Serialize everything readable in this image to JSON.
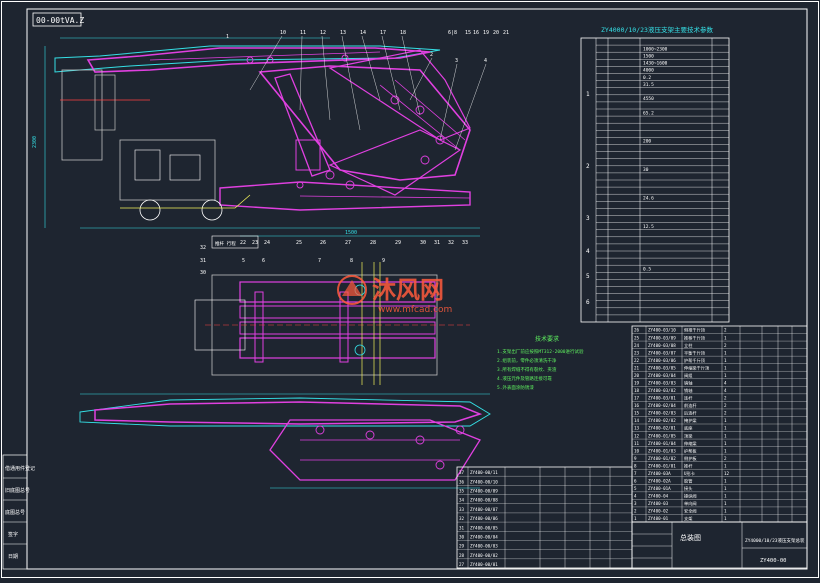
{
  "drawing_code_rotated": "00-00tVA.Z",
  "spec_table_title": "ZY4000/10/23液压支架主要技术参数",
  "spec_row_numbers": [
    "1",
    "2",
    "3",
    "4",
    "5",
    "6"
  ],
  "spec_values": [
    "1000~2300",
    "1500",
    "1430~1600",
    "4000",
    "0.2",
    "31.5",
    "4550",
    "65.2",
    "200",
    "30",
    "24.6",
    "12.5",
    "0.5"
  ],
  "balloons_top": [
    "6|8",
    "15",
    "16",
    "19",
    "20",
    "21",
    "10",
    "11",
    "12",
    "13",
    "14",
    "17",
    "18",
    "1",
    "2",
    "3",
    "4"
  ],
  "balloons_bottom": [
    "22",
    "23",
    "24",
    "25",
    "26",
    "27",
    "28",
    "29",
    "30",
    "31",
    "32",
    "33"
  ],
  "balloons_plan": [
    "32",
    "31",
    "30",
    "5",
    "6",
    "7",
    "8",
    "9"
  ],
  "notes_title": "技术要求",
  "notes_lines": [
    "1.支架出厂前应按照MT312-2000进行试验",
    "2.组装前，零件必须清洗干净",
    "3.所有焊缝不得有裂纹、夹渣",
    "4.液压元件及管路连接可靠",
    "5.外表面涂防锈漆"
  ],
  "bom_rows_right": [
    [
      "26",
      "ZY400-03/10",
      "侧推千斤顶",
      "2"
    ],
    [
      "25",
      "ZY400-03/09",
      "推移千斤顶",
      "1"
    ],
    [
      "24",
      "ZY400-03/08",
      "立柱",
      "2"
    ],
    [
      "23",
      "ZY400-03/07",
      "平衡千斤顶",
      "1"
    ],
    [
      "22",
      "ZY400-03/06",
      "护帮千斤顶",
      "1"
    ],
    [
      "21",
      "ZY400-03/05",
      "伸缩梁千斤顶",
      "1"
    ],
    [
      "20",
      "ZY400-03/04",
      "阀组",
      "1"
    ],
    [
      "19",
      "ZY400-03/03",
      "销轴",
      "4"
    ],
    [
      "18",
      "ZY400-03/02",
      "销轴",
      "4"
    ],
    [
      "17",
      "ZY400-03/01",
      "连杆",
      "2"
    ],
    [
      "16",
      "ZY400-02/04",
      "前连杆",
      "2"
    ],
    [
      "15",
      "ZY400-02/03",
      "后连杆",
      "2"
    ],
    [
      "14",
      "ZY400-02/02",
      "掩护梁",
      "1"
    ],
    [
      "13",
      "ZY400-02/01",
      "底座",
      "1"
    ],
    [
      "12",
      "ZY400-01/05",
      "顶梁",
      "1"
    ],
    [
      "11",
      "ZY400-01/04",
      "伸缩梁",
      "1"
    ],
    [
      "10",
      "ZY400-01/03",
      "护帮板",
      "1"
    ],
    [
      "9",
      "ZY400-01/02",
      "侧护板",
      "2"
    ],
    [
      "8",
      "ZY400-01/01",
      "推杆",
      "1"
    ],
    [
      "7",
      "ZY400-03A",
      "U形卡",
      "12"
    ],
    [
      "6",
      "ZY400-02A",
      "胶管",
      "1"
    ],
    [
      "5",
      "ZY400-01A",
      "接头",
      "1"
    ],
    [
      "4",
      "ZY400-04",
      "操纵阀",
      "1"
    ],
    [
      "3",
      "ZY400-03",
      "单向阀",
      "1"
    ],
    [
      "2",
      "ZY400-02",
      "安全阀",
      "1"
    ],
    [
      "1",
      "ZY400-01",
      "支架",
      "1"
    ]
  ],
  "bom_rows_left": [
    [
      "37",
      "ZY400-00/11"
    ],
    [
      "36",
      "ZY400-00/10"
    ],
    [
      "35",
      "ZY400-00/09"
    ],
    [
      "34",
      "ZY400-00/08"
    ],
    [
      "33",
      "ZY400-00/07"
    ],
    [
      "32",
      "ZY400-00/06"
    ],
    [
      "31",
      "ZY400-00/05"
    ],
    [
      "30",
      "ZY400-00/04"
    ],
    [
      "29",
      "ZY400-00/03"
    ],
    [
      "28",
      "ZY400-00/02"
    ],
    [
      "27",
      "ZY400-00/01"
    ]
  ],
  "title_block": {
    "drawing_title": "总装图",
    "drawing_name": "ZY4000/10/23液压支架总装",
    "drawing_no": "ZY400-00"
  },
  "side_stamp_labels": [
    "借通用件登记",
    "旧底图总号",
    "底图总号",
    "签字",
    "日期"
  ],
  "watermark": {
    "name": "沐风网",
    "url": "www.mfcad.com"
  },
  "colors": {
    "background": "#1e2530",
    "frame": "#ffffff",
    "part_magenta": "#e040e0",
    "cyan": "#35e0e6",
    "green": "#5ff25f",
    "yellow": "#f2f25a",
    "red": "#ff4040",
    "watermark": "#ff5a3c"
  }
}
